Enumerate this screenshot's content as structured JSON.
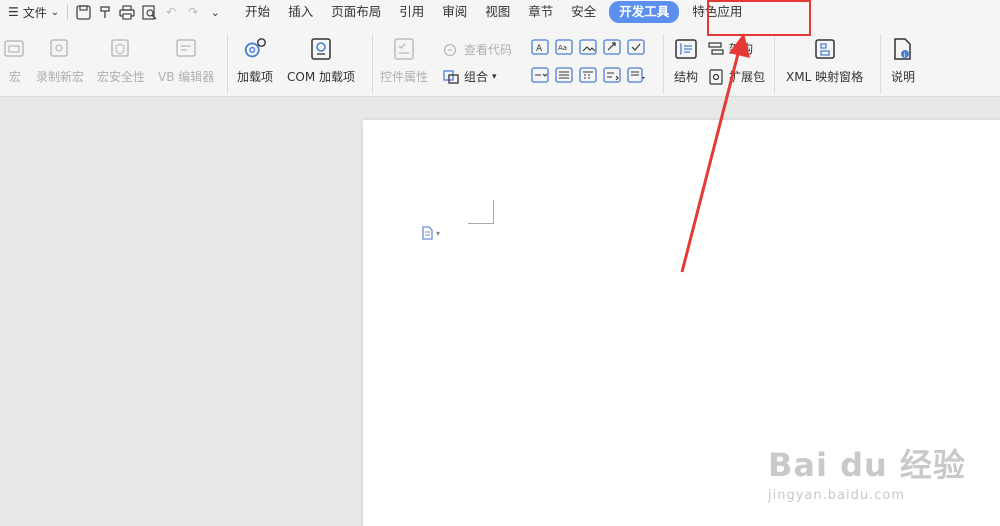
{
  "menubar": {
    "file_label": "文件",
    "tabs": [
      "开始",
      "插入",
      "页面布局",
      "引用",
      "审阅",
      "视图",
      "章节",
      "安全",
      "开发工具",
      "特色应用"
    ],
    "active_tab": "开发工具"
  },
  "ribbon": {
    "macro": "宏",
    "record_macro": "录制新宏",
    "macro_security": "宏安全性",
    "vb_editor": "VB 编辑器",
    "addins": "加载项",
    "com_addins": "COM 加载项",
    "control_props": "控件属性",
    "view_code": "查看代码",
    "group": "组合",
    "structure": "结构",
    "architecture": "架构",
    "expansion_pack": "扩展包",
    "xml_mapping": "XML 映射窗格",
    "help": "说明"
  },
  "colors": {
    "accent": "#5b8ff0",
    "highlight": "#e53935"
  },
  "icons": {
    "macro": "macro-icon",
    "record": "record-macro-icon",
    "security": "macro-security-icon",
    "vb": "vb-editor-icon",
    "addin": "gear-addin-icon",
    "com": "com-addin-icon",
    "save": "save-icon",
    "undo": "undo-icon",
    "redo": "redo-icon"
  },
  "watermark": {
    "logo": "Bai du 经验",
    "url": "jingyan.baidu.com"
  }
}
